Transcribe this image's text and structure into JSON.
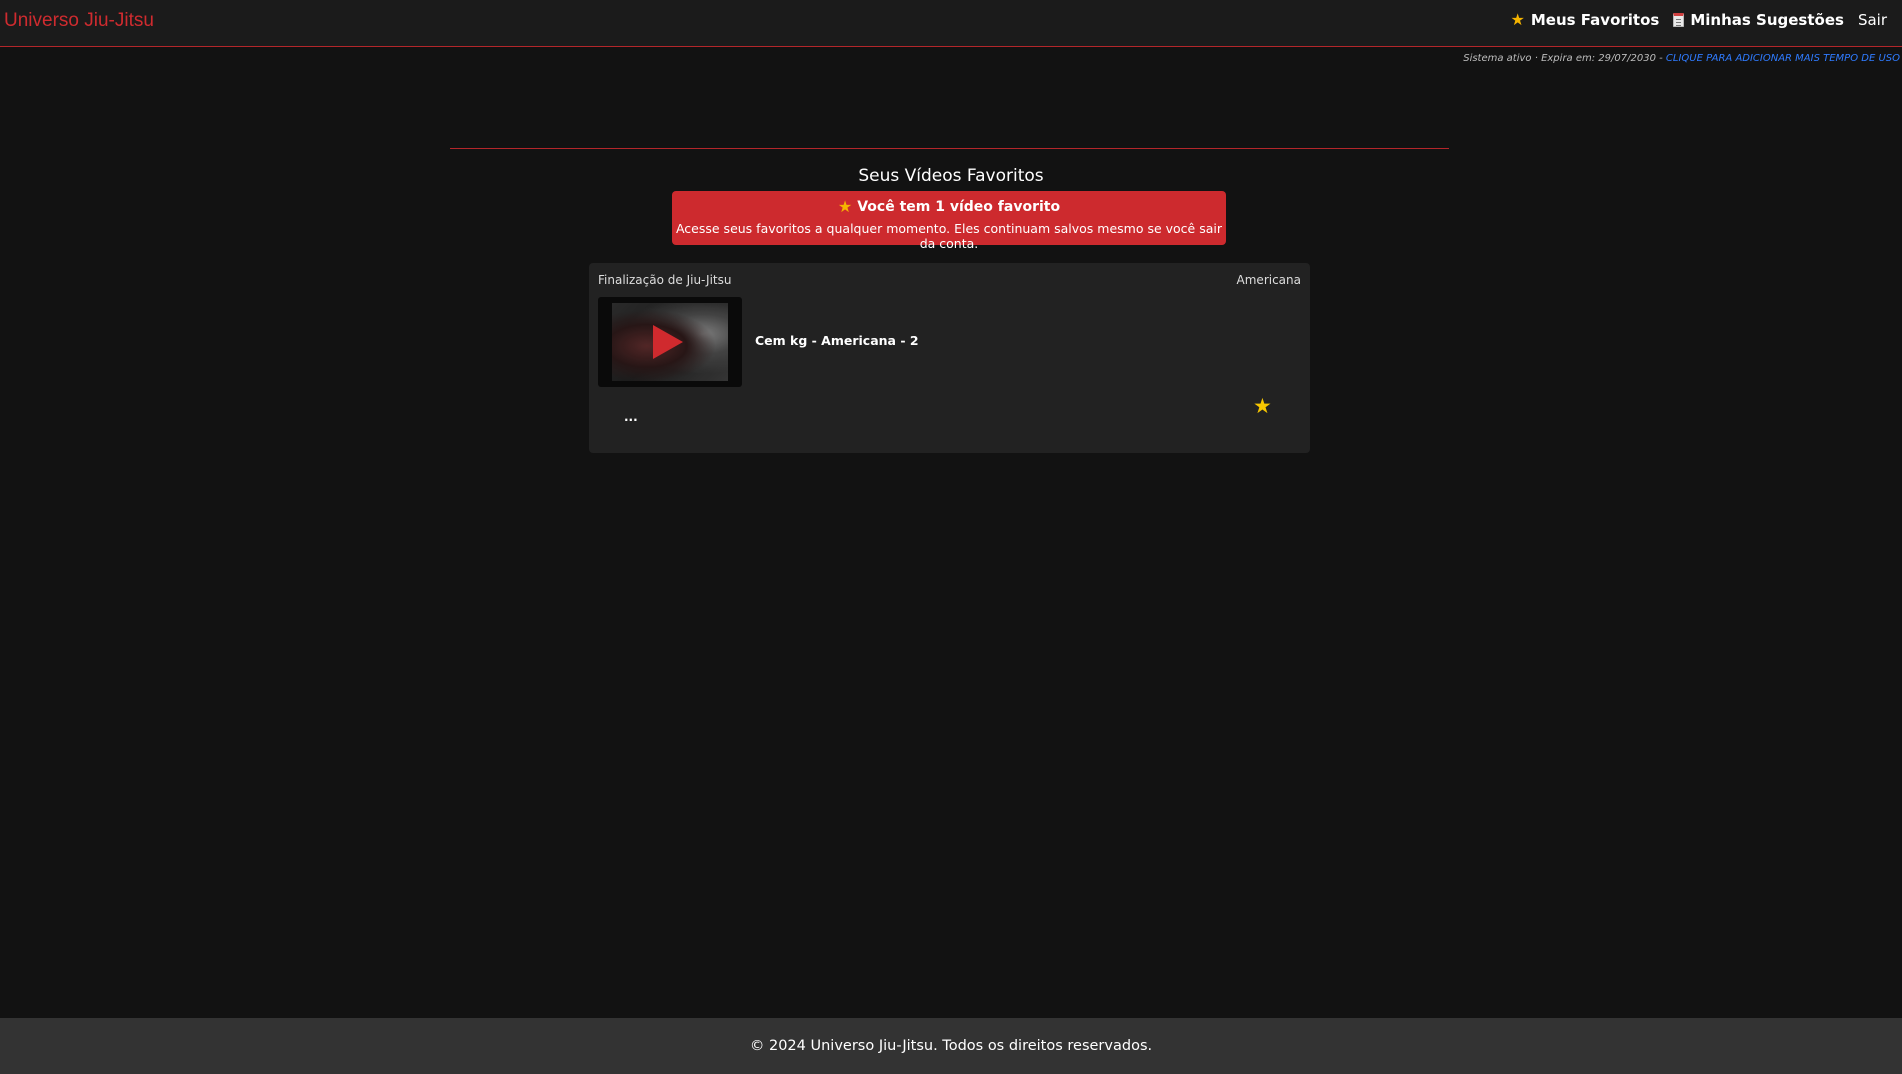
{
  "header": {
    "brand": "Universo Jiu-Jitsu",
    "nav": {
      "favorites_label": "Meus Favoritos",
      "suggestions_label": "Minhas Sugestões",
      "logout_label": "Sair"
    },
    "icons": {
      "favorites": "star-icon",
      "suggestions": "clipboard-icon"
    },
    "brand_color": "#cf2b2f"
  },
  "status": {
    "text": "Sistema ativo · Expira em: 29/07/2030 - ",
    "link": "CLIQUE PARA ADICIONAR MAIS TEMPO DE USO",
    "link_color": "#2f7bff"
  },
  "main": {
    "title": "Seus Vídeos Favoritos",
    "alert": {
      "title": "Você tem 1 vídeo favorito",
      "text": "Acesse seus favoritos a qualquer momento. Eles continuam salvos mesmo se você sair da conta.",
      "background": "#cd2a2e"
    },
    "videos": [
      {
        "category": "Finalização de Jiu-Jitsu",
        "tag": "Americana",
        "title": "Cem kg - Americana - 2",
        "description": "...",
        "favorite": true,
        "thumbnail_icon": "play-icon",
        "favorite_icon": "star-icon"
      }
    ]
  },
  "footer": {
    "text": "© 2024 Universo Jiu-Jitsu. Todos os direitos reservados."
  }
}
